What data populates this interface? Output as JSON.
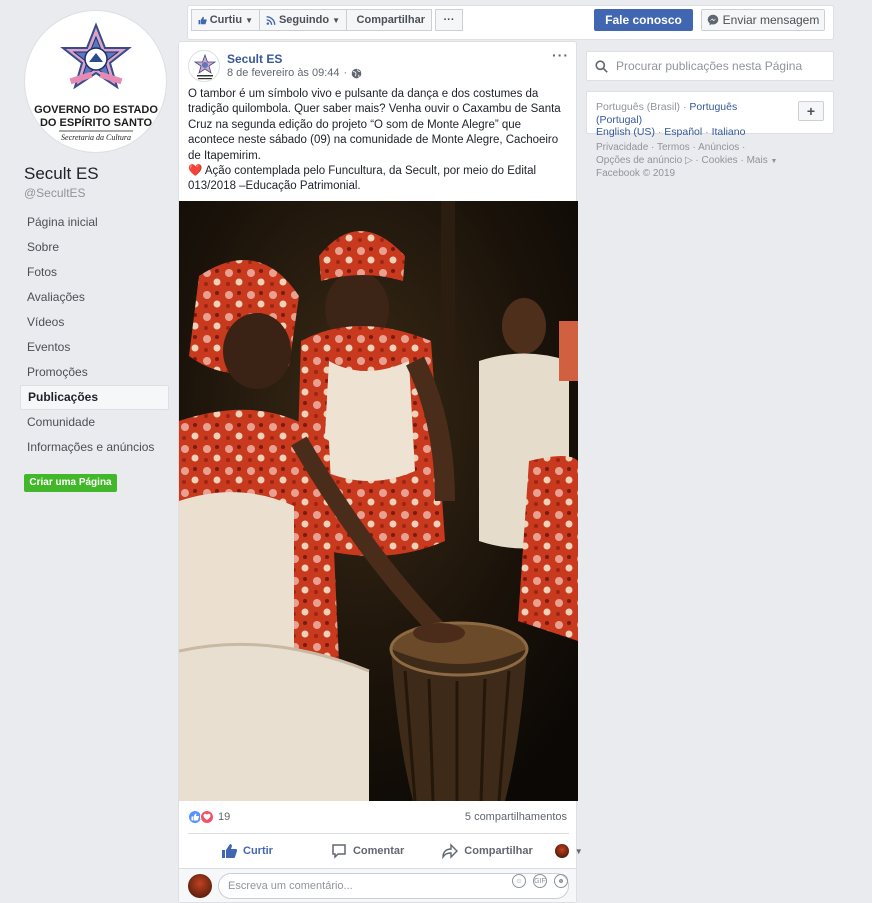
{
  "page": {
    "name": "Secult ES",
    "handle": "@SecultES",
    "logo_text": [
      "GOVERNO DO ESTADO",
      "DO ESPÍRITO SANTO",
      "Secretaria da Cultura"
    ]
  },
  "nav": {
    "items": [
      {
        "label": "Página inicial"
      },
      {
        "label": "Sobre"
      },
      {
        "label": "Fotos"
      },
      {
        "label": "Avaliações"
      },
      {
        "label": "Vídeos"
      },
      {
        "label": "Eventos"
      },
      {
        "label": "Promoções"
      },
      {
        "label": "Publicações"
      },
      {
        "label": "Comunidade"
      },
      {
        "label": "Informações e anúncios"
      }
    ],
    "active": "Publicações",
    "create_page": "Criar uma Página"
  },
  "topbar": {
    "liked": "Curtiu",
    "following": "Seguindo",
    "share": "Compartilhar",
    "more": "···",
    "contact": "Fale conosco",
    "message": "Enviar mensagem"
  },
  "post": {
    "author": "Secult ES",
    "date": "8 de fevereiro às 09:44",
    "text1": "O tambor é um símbolo vivo e pulsante da dança e dos costumes da tradição quilombola. Quer saber mais? Venha ouvir o Caxambu de Santa Cruz na segunda edição do projeto “O som de Monte Alegre” que acontece neste sábado (09) na comunidade de Monte Alegre, Cachoeiro de Itapemirim.",
    "heart": "❤️",
    "text2": "Ação contemplada pelo Funcultura, da Secult, por meio do Edital 013/2018 –Educação Patrimonial.",
    "reaction_count": "19",
    "shares": "5 compartilhamentos",
    "like_label": "Curtir",
    "comment_label": "Comentar",
    "share_label": "Compartilhar",
    "comment_placeholder": "Escreva um comentário..."
  },
  "sidebar": {
    "search_placeholder": "Procurar publicações nesta Página",
    "lang_current": "Português (Brasil)",
    "lang_links": [
      "Português (Portugal)",
      "English (US)",
      "Español",
      "Italiano"
    ],
    "add": "+",
    "footer_links": [
      "Privacidade",
      "Termos",
      "Anúncios",
      "Opções de anúncio",
      "Cookies",
      "Mais"
    ],
    "copyright": "Facebook © 2019"
  },
  "colors": {
    "brand": "#4267b2",
    "link": "#365899",
    "green": "#42b72a",
    "background": "#e9ebee"
  }
}
